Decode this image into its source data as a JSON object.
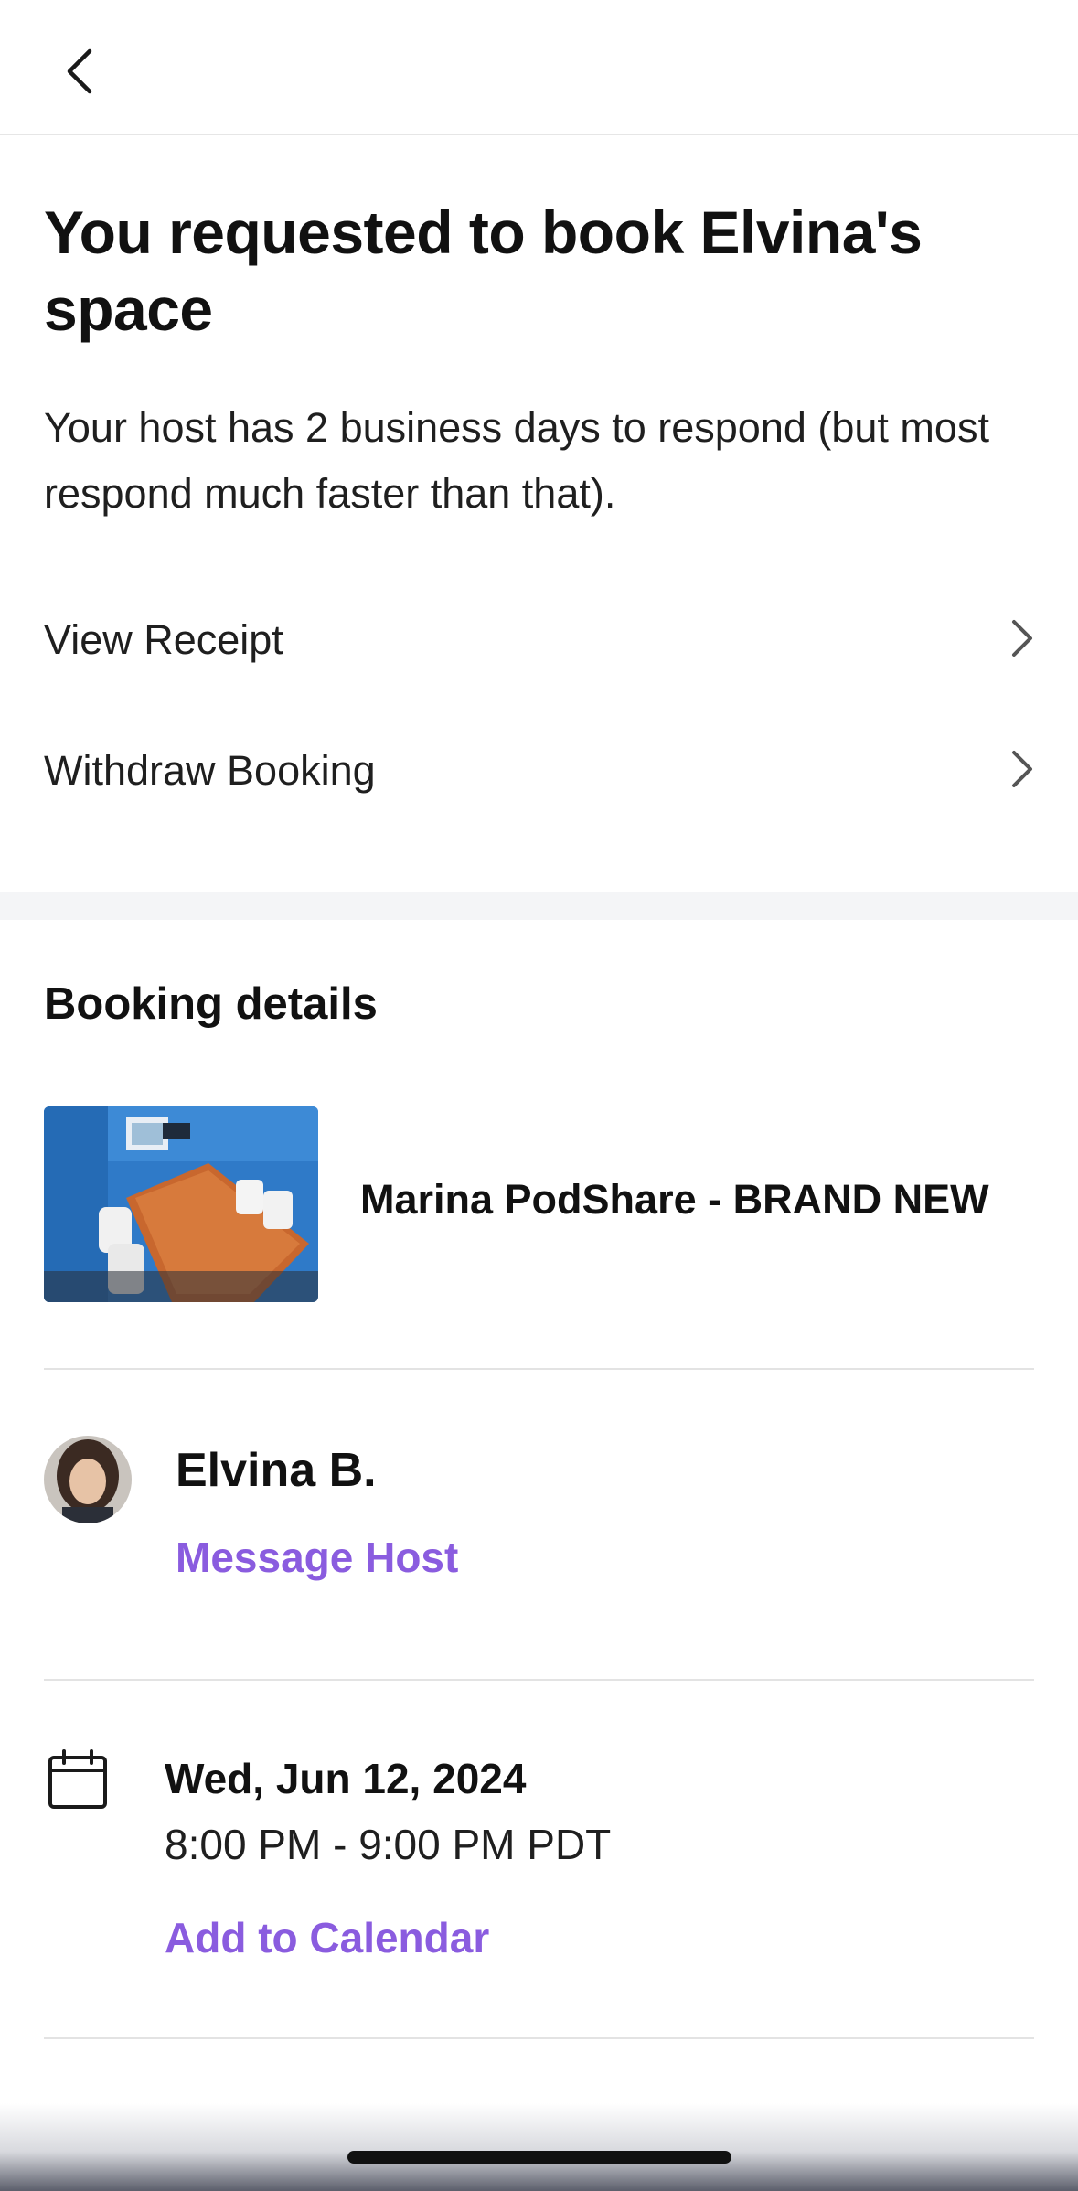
{
  "header": {
    "back_icon": "chevron-left-icon"
  },
  "main": {
    "headline": "You requested to book Elvina's space",
    "subtext": "Your host has 2 business days to respond (but most respond much faster than that).",
    "actions": [
      {
        "label": "View Receipt",
        "icon": "chevron-right-icon"
      },
      {
        "label": "Withdraw Booking",
        "icon": "chevron-right-icon"
      }
    ]
  },
  "booking": {
    "section_title": "Booking details",
    "space_name": "Marina PodShare - BRAND NEW",
    "host": {
      "name": "Elvina B.",
      "message_label": "Message Host"
    },
    "schedule": {
      "date": "Wed, Jun 12, 2024",
      "time": "8:00 PM - 9:00 PM PDT",
      "calendar_label": "Add to Calendar",
      "icon": "calendar-icon"
    }
  },
  "colors": {
    "link": "#8a5cdf",
    "divider": "#e3e3e3",
    "section_gap": "#f4f5f7"
  }
}
